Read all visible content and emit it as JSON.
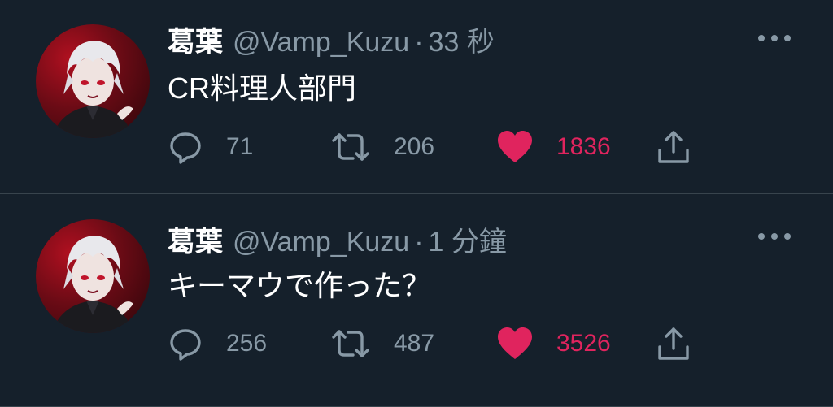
{
  "tweets": [
    {
      "name": "葛葉",
      "handle": "@Vamp_Kuzu",
      "separator": "·",
      "time": "33 秒",
      "text": "CR料理人部門",
      "replies": "71",
      "retweets": "206",
      "likes": "1836"
    },
    {
      "name": "葛葉",
      "handle": "@Vamp_Kuzu",
      "separator": "·",
      "time": "1 分鐘",
      "text": "キーマウで作った？",
      "replies": "256",
      "retweets": "487",
      "likes": "3526"
    }
  ],
  "colors": {
    "background": "#15202b",
    "muted": "#8899a6",
    "like": "#e0245e",
    "divider": "#38444d"
  },
  "icons": [
    "reply-icon",
    "retweet-icon",
    "heart-icon",
    "share-icon",
    "more-icon"
  ]
}
